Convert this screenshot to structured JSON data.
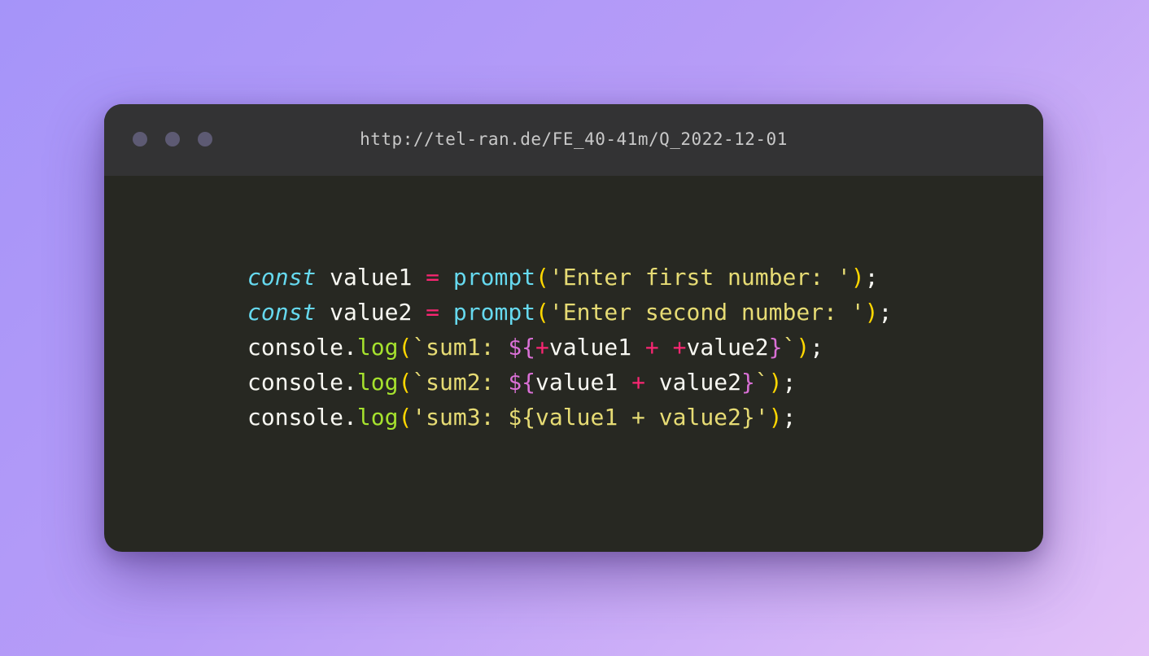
{
  "window": {
    "title_url": "http://tel-ran.de/FE_40-41m/Q_2022-12-01",
    "controls": [
      "window-dot",
      "window-dot",
      "window-dot"
    ]
  },
  "code": {
    "language": "javascript",
    "lines": [
      [
        {
          "t": "const",
          "c": "kw"
        },
        {
          "t": " ",
          "c": "pl"
        },
        {
          "t": "value1",
          "c": "id"
        },
        {
          "t": " ",
          "c": "pl"
        },
        {
          "t": "=",
          "c": "op"
        },
        {
          "t": " ",
          "c": "pl"
        },
        {
          "t": "prompt",
          "c": "fn"
        },
        {
          "t": "(",
          "c": "pn"
        },
        {
          "t": "'Enter first number: '",
          "c": "st"
        },
        {
          "t": ")",
          "c": "pn"
        },
        {
          "t": ";",
          "c": "pl"
        }
      ],
      [
        {
          "t": "const",
          "c": "kw"
        },
        {
          "t": " ",
          "c": "pl"
        },
        {
          "t": "value2",
          "c": "id"
        },
        {
          "t": " ",
          "c": "pl"
        },
        {
          "t": "=",
          "c": "op"
        },
        {
          "t": " ",
          "c": "pl"
        },
        {
          "t": "prompt",
          "c": "fn"
        },
        {
          "t": "(",
          "c": "pn"
        },
        {
          "t": "'Enter second number: '",
          "c": "st"
        },
        {
          "t": ")",
          "c": "pn"
        },
        {
          "t": ";",
          "c": "pl"
        }
      ],
      [
        {
          "t": "console",
          "c": "id"
        },
        {
          "t": ".",
          "c": "pl"
        },
        {
          "t": "log",
          "c": "mt"
        },
        {
          "t": "(",
          "c": "pn"
        },
        {
          "t": "`sum1: ",
          "c": "st"
        },
        {
          "t": "${",
          "c": "ip"
        },
        {
          "t": "+",
          "c": "op"
        },
        {
          "t": "value1",
          "c": "id"
        },
        {
          "t": " ",
          "c": "pl"
        },
        {
          "t": "+",
          "c": "op"
        },
        {
          "t": " ",
          "c": "pl"
        },
        {
          "t": "+",
          "c": "op"
        },
        {
          "t": "value2",
          "c": "id"
        },
        {
          "t": "}",
          "c": "ip"
        },
        {
          "t": "`",
          "c": "st"
        },
        {
          "t": ")",
          "c": "pn"
        },
        {
          "t": ";",
          "c": "pl"
        }
      ],
      [
        {
          "t": "console",
          "c": "id"
        },
        {
          "t": ".",
          "c": "pl"
        },
        {
          "t": "log",
          "c": "mt"
        },
        {
          "t": "(",
          "c": "pn"
        },
        {
          "t": "`sum2: ",
          "c": "st"
        },
        {
          "t": "${",
          "c": "ip"
        },
        {
          "t": "value1",
          "c": "id"
        },
        {
          "t": " ",
          "c": "pl"
        },
        {
          "t": "+",
          "c": "op"
        },
        {
          "t": " ",
          "c": "pl"
        },
        {
          "t": "value2",
          "c": "id"
        },
        {
          "t": "}",
          "c": "ip"
        },
        {
          "t": "`",
          "c": "st"
        },
        {
          "t": ")",
          "c": "pn"
        },
        {
          "t": ";",
          "c": "pl"
        }
      ],
      [
        {
          "t": "console",
          "c": "id"
        },
        {
          "t": ".",
          "c": "pl"
        },
        {
          "t": "log",
          "c": "mt"
        },
        {
          "t": "(",
          "c": "pn"
        },
        {
          "t": "'sum3: ${value1 + value2}'",
          "c": "st"
        },
        {
          "t": ")",
          "c": "pn"
        },
        {
          "t": ";",
          "c": "pl"
        }
      ]
    ]
  },
  "colors": {
    "background_start": "#a594f9",
    "background_end": "#e3c2f8",
    "editor_bg": "#272822",
    "titlebar_bg": "#333334",
    "window_dot": "#5d5a73",
    "keyword": "#66d9ef",
    "operator": "#f92672",
    "string": "#e6db74",
    "method": "#a6e22e",
    "bracket": "#ffd700",
    "interpolation": "#da70d6",
    "plain": "#f8f8f2"
  }
}
